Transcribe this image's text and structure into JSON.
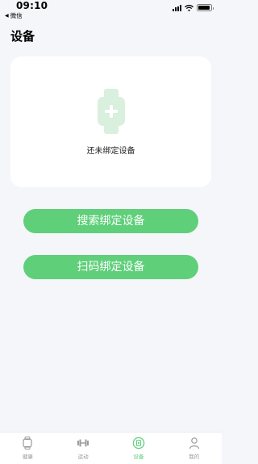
{
  "status_bar": {
    "time": "09:10",
    "back_app": "微信",
    "battery_level": 0.9
  },
  "header": {
    "title": "设备"
  },
  "device_card": {
    "icon": "watch-plus-icon",
    "empty_text": "还未绑定设备"
  },
  "actions": {
    "search_bind_label": "搜索绑定设备",
    "scan_bind_label": "扫码绑定设备"
  },
  "tab_bar": {
    "tabs": [
      {
        "label": "健康",
        "icon": "watch-icon",
        "active": false
      },
      {
        "label": "运动",
        "icon": "dumbbell-icon",
        "active": false
      },
      {
        "label": "设备",
        "icon": "device-icon",
        "active": true
      },
      {
        "label": "我的",
        "icon": "person-icon",
        "active": false
      }
    ]
  },
  "colors": {
    "accent": "#5fcf7a",
    "watch_icon": "#d8f0dd",
    "background": "#f5f6fa",
    "inactive_tab": "#9a9a9a"
  }
}
